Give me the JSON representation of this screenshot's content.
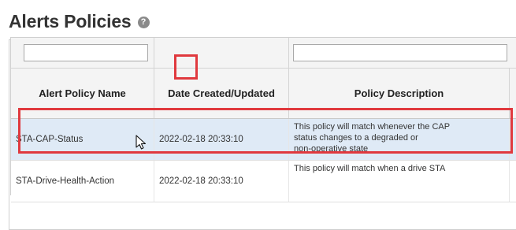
{
  "page": {
    "title": "Alerts Policies",
    "help_glyph": "?"
  },
  "toolbar": {
    "buttons": [
      {
        "name": "filter-icon"
      },
      {
        "name": "clear-filter-icon"
      },
      {
        "name": "add-icon"
      },
      {
        "name": "edit-icon"
      },
      {
        "name": "copy-icon"
      },
      {
        "name": "notebook-icon",
        "highlighted": true
      },
      {
        "name": "mail-icon"
      },
      {
        "name": "delete-icon"
      },
      {
        "name": "refresh-icon"
      },
      {
        "name": "print-icon"
      }
    ]
  },
  "grid": {
    "columns": [
      {
        "label": "Alert Policy Name"
      },
      {
        "label": "Date Created/Updated"
      },
      {
        "label": "Policy Description"
      }
    ],
    "filters": [
      {
        "value": ""
      },
      {
        "value": ""
      }
    ],
    "rows": [
      {
        "name": "STA-CAP-Status",
        "date": "2022-02-18 20:33:10",
        "description": "This policy will match whenever the CAP\nstatus changes to a degraded or\nnon-operative state",
        "selected": true
      },
      {
        "name": "STA-Drive-Health-Action",
        "date": "2022-02-18 20:33:10",
        "description": "This policy will match when a drive STA",
        "selected": false
      }
    ]
  },
  "colors": {
    "highlight": "#e0393e",
    "selected_row": "#dfeaf6",
    "header_bg": "#f4f4f4"
  }
}
